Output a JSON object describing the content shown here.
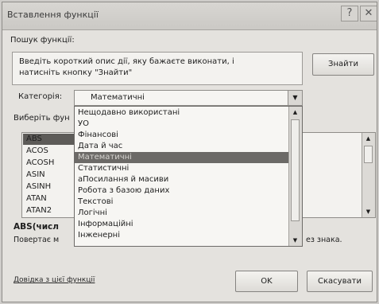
{
  "window": {
    "title": "Вставлення функції",
    "help_icon": "?",
    "close_icon": "✕"
  },
  "search": {
    "label": "Пошук функції:",
    "description_line1": "Введіть короткий опис дії, яку бажаєте виконати, і",
    "description_line2": "натисніть кнопку \"Знайти\"",
    "find_button": "Знайти"
  },
  "category": {
    "label": "Категорія:",
    "selected": "Математичні",
    "options": [
      "Нещодавно використані",
      "УО",
      "Фінансові",
      "Дата й час",
      "Математичні",
      "Статистичні",
      "аПосилання й масиви",
      "Робота з базою даних",
      "Текстові",
      "Логічні",
      "Інформаційні",
      "Інженерні"
    ],
    "selected_index": 4
  },
  "functions": {
    "label": "Виберіть фун",
    "items": [
      "ABS",
      "ACOS",
      "ACOSH",
      "ASIN",
      "ASINH",
      "ATAN",
      "ATAN2"
    ],
    "selected_index": 0
  },
  "signature": "ABS(числ",
  "function_description": "Повертає м",
  "function_description_tail": "ез знака.",
  "help_link": "Довідка з цієї функції",
  "ok_button": "OK",
  "cancel_button": "Скасувати"
}
